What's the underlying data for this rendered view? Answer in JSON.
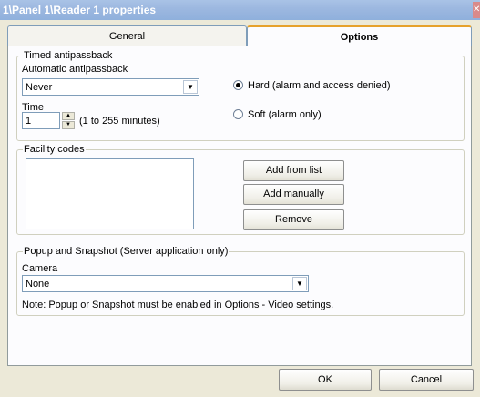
{
  "window": {
    "title": "1\\Panel 1\\Reader 1 properties"
  },
  "tabs": [
    {
      "label": "General"
    },
    {
      "label": "Options"
    }
  ],
  "timed_antipassback": {
    "legend": "Timed antipassback",
    "automatic_label": "Automatic antipassback",
    "automatic_value": "Never",
    "time_label": "Time",
    "time_value": "1",
    "time_range": "(1 to 255 minutes)",
    "radio_hard": "Hard (alarm and access denied)",
    "radio_soft": "Soft (alarm only)"
  },
  "facility_codes": {
    "legend": "Facility codes",
    "add_from_list": "Add from list",
    "add_manually": "Add manually",
    "remove": "Remove"
  },
  "popup_snapshot": {
    "legend": "Popup and Snapshot  (Server application only)",
    "camera_label": "Camera",
    "camera_value": "None",
    "note": "Note: Popup or Snapshot must be enabled in Options - Video settings."
  },
  "footer": {
    "ok": "OK",
    "cancel": "Cancel"
  },
  "colors": {
    "dialog_bg": "#ece9d8",
    "panel_bg": "#fcfcfe",
    "tab_highlight": "#e6a12c"
  }
}
